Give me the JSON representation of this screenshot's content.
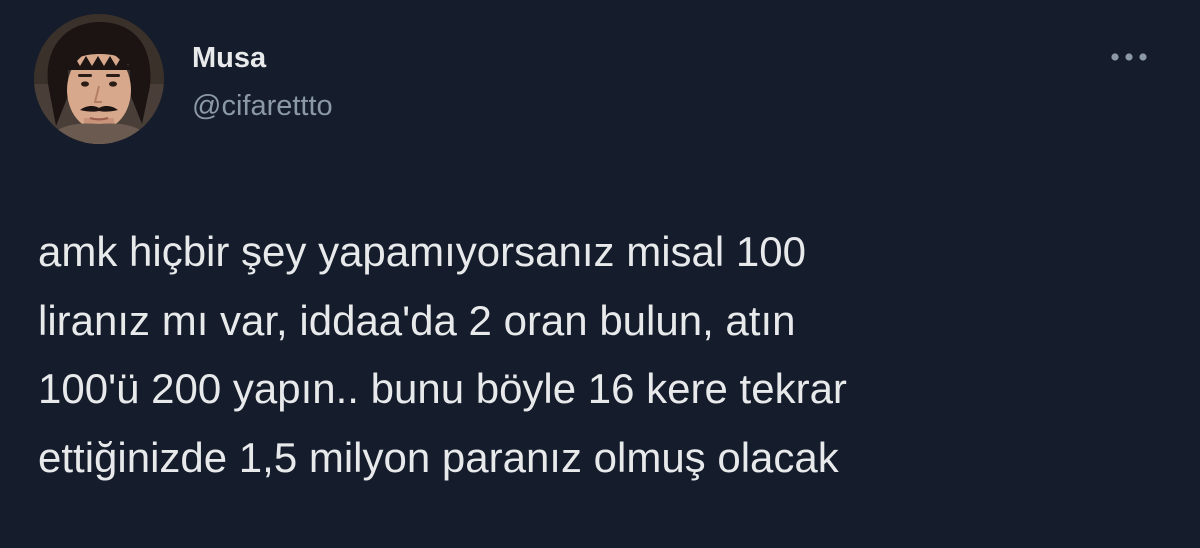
{
  "author": {
    "display_name": "Musa",
    "handle": "@cifarettto",
    "avatar_icon": "profile-photo"
  },
  "menu": {
    "more_icon": "more-horizontal-icon"
  },
  "tweet": {
    "lines": [
      "amk hiçbir şey yapamıyorsanız misal 100",
      "liranız mı var, iddaa'da 2 oran bulun, atın",
      "100'ü 200 yapın.. bunu böyle 16 kere tekrar",
      "ettiğinizde 1,5 milyon paranız olmuş olacak"
    ]
  },
  "colors": {
    "background": "#151c2b",
    "primary_text": "#e7e9ea",
    "secondary_text": "#8b98a5"
  }
}
